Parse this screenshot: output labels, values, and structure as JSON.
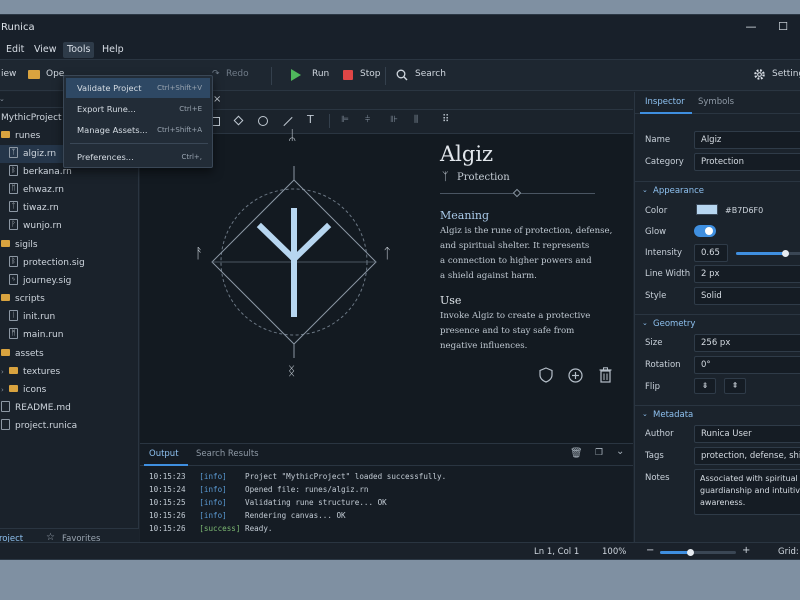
{
  "app": {
    "title": "Runica"
  },
  "window_controls": {
    "minimize": "—",
    "maximize": "☐"
  },
  "menu": [
    "Edit",
    "View",
    "Tools",
    "Help"
  ],
  "dropdown": [
    {
      "label": "Validate Project",
      "shortcut": "Ctrl+Shift+V"
    },
    {
      "label": "Export Rune...",
      "shortcut": "Ctrl+E"
    },
    {
      "label": "Manage Assets...",
      "shortcut": "Ctrl+Shift+A"
    },
    {
      "label": "Preferences...",
      "shortcut": "Ctrl+,"
    }
  ],
  "toolbar": {
    "new": "iew",
    "open": "Ope",
    "redo": "Redo",
    "run": "Run",
    "stop": "Stop",
    "search": "Search",
    "settings": "Settings"
  },
  "tree": {
    "project": "MythicProject",
    "folders": {
      "runes": "runes",
      "sigils": "sigils",
      "scripts": "scripts",
      "assets": "assets",
      "textures": "textures",
      "icons": "icons"
    },
    "runes": [
      {
        "icon": "ᛉ",
        "name": "algiz.rn"
      },
      {
        "icon": "ᛒ",
        "name": "berkana.rn"
      },
      {
        "icon": "ᛖ",
        "name": "ehwaz.rn"
      },
      {
        "icon": "ᛏ",
        "name": "tiwaz.rn"
      },
      {
        "icon": "ᚹ",
        "name": "wunjo.rn"
      }
    ],
    "sigils": [
      {
        "icon": "ᛒ",
        "name": "protection.sig"
      },
      {
        "icon": "ᛃ",
        "name": "journey.sig"
      }
    ],
    "scripts": [
      {
        "icon": "ᛁ",
        "name": "init.run"
      },
      {
        "icon": "ᛗ",
        "name": "main.run"
      }
    ],
    "files": [
      "README.md",
      "project.runica"
    ]
  },
  "left_tabs": {
    "project": "roject",
    "favorites": "Favorites"
  },
  "editor": {
    "close": "×"
  },
  "rune": {
    "name": "Algiz",
    "glyph": "ᛉ",
    "subtitle": "Protection",
    "meaning_heading": "Meaning",
    "meaning_lines": [
      "Algiz is the rune of protection, defense,",
      "and spiritual shelter. It represents",
      "a connection to higher powers and",
      "a shield against harm."
    ],
    "use_heading": "Use",
    "use_lines": [
      "Invoke Algiz to create a protective",
      "presence and to stay safe from",
      "negative influences."
    ],
    "diagram_runes": {
      "top": "ᛦ",
      "left": "ᚨ",
      "right": "ᛏ",
      "bottom": "ᛝ"
    }
  },
  "output": {
    "tabs": [
      "Output",
      "Search Results"
    ],
    "lines": [
      {
        "time": "10:15:23",
        "level": "[info]",
        "msg": "Project \"MythicProject\" loaded successfully."
      },
      {
        "time": "10:15:24",
        "level": "[info]",
        "msg": "Opened file: runes/algiz.rn"
      },
      {
        "time": "10:15:25",
        "level": "[info]",
        "msg": "Validating rune structure... OK"
      },
      {
        "time": "10:15:26",
        "level": "[info]",
        "msg": "Rendering canvas... OK"
      },
      {
        "time": "10:15:26",
        "level": "[success]",
        "msg": "Ready."
      }
    ]
  },
  "inspector": {
    "tabs": [
      "Inspector",
      "Symbols"
    ],
    "name_label": "Name",
    "name_value": "Algiz",
    "category_label": "Category",
    "category_value": "Protection",
    "appearance": "Appearance",
    "color_label": "Color",
    "color_value": "#B7D6F0",
    "color_hex": "#B7D6F0",
    "glow_label": "Glow",
    "glow_on": true,
    "intensity_label": "Intensity",
    "intensity_value": "0.65",
    "intensity_level": 0.65,
    "linewidth_label": "Line Width",
    "linewidth_value": "2 px",
    "style_label": "Style",
    "style_value": "Solid",
    "geometry": "Geometry",
    "size_label": "Size",
    "size_value": "256 px",
    "rotation_label": "Rotation",
    "rotation_value": "0°",
    "flip_label": "Flip",
    "metadata": "Metadata",
    "author_label": "Author",
    "author_value": "Runica User",
    "tags_label": "Tags",
    "tags_value": "protection, defense, shield",
    "notes_label": "Notes",
    "notes_lines": [
      "Associated with spiritual",
      "guardianship and intuitive",
      "awareness."
    ]
  },
  "status": {
    "position": "Ln 1, Col 1",
    "zoom": "100%",
    "zoom_out": "−",
    "zoom_in": "+",
    "zoom_level": 0.4,
    "grid": "Grid: O"
  },
  "colors": {
    "accent": "#3f8fe0",
    "folder": "#d9a33f",
    "rune": "#b7d6f0"
  }
}
